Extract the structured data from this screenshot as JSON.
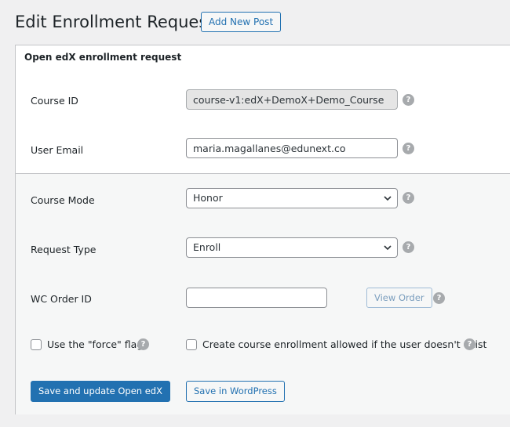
{
  "page": {
    "title": "Edit Enrollment Request",
    "add_new_label": "Add New Post"
  },
  "box": {
    "title": "Open edX enrollment request"
  },
  "fields": {
    "course_id": {
      "label": "Course ID",
      "value": "course-v1:edX+DemoX+Demo_Course"
    },
    "user_email": {
      "label": "User Email",
      "value": "maria.magallanes@edunext.co"
    },
    "course_mode": {
      "label": "Course Mode",
      "value": "Honor"
    },
    "request_type": {
      "label": "Request Type",
      "value": "Enroll"
    },
    "wc_order_id": {
      "label": "WC Order ID",
      "value": "",
      "view_order_label": "View Order"
    }
  },
  "checkboxes": {
    "force": {
      "label": "Use the \"force\" flag",
      "checked": false
    },
    "create_allowed": {
      "label": "Create course enrollment allowed if the user doesn't exist",
      "checked": false
    }
  },
  "actions": {
    "save_update_label": "Save and update Open edX",
    "save_wp_label": "Save in WordPress"
  },
  "help_glyph": "?",
  "icons": {
    "help": "question-circle-icon",
    "dropdown": "chevron-down-icon"
  },
  "colors": {
    "accent": "#2271b1",
    "background": "#f0f0f1",
    "help_icon": "#a7aaad"
  }
}
